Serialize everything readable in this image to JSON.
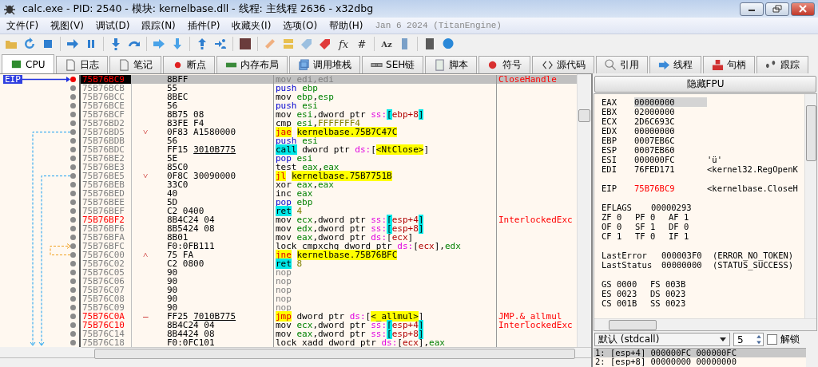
{
  "window": {
    "title": "calc.exe - PID: 2540 - 模块: kernelbase.dll - 线程: 主线程 2636 - x32dbg"
  },
  "menu": [
    "文件(F)",
    "视图(V)",
    "调试(D)",
    "跟踪(N)",
    "插件(P)",
    "收藏夹(I)",
    "选项(O)",
    "帮助(H)"
  ],
  "build_info": "Jan 6 2024 (TitanEngine)",
  "toolbar_glyphs": [
    "fx",
    "#",
    "Az"
  ],
  "tabs": [
    {
      "label": "CPU",
      "selected": true
    },
    {
      "label": "日志",
      "selected": false
    },
    {
      "label": "笔记",
      "selected": false
    },
    {
      "label": "断点",
      "selected": false
    },
    {
      "label": "内存布局",
      "selected": false
    },
    {
      "label": "调用堆栈",
      "selected": false
    },
    {
      "label": "SEH链",
      "selected": false
    },
    {
      "label": "脚本",
      "selected": false
    },
    {
      "label": "符号",
      "selected": false
    },
    {
      "label": "源代码",
      "selected": false
    },
    {
      "label": "引用",
      "selected": false
    },
    {
      "label": "线程",
      "selected": false
    },
    {
      "label": "句柄",
      "selected": false
    },
    {
      "label": "跟踪",
      "selected": false
    }
  ],
  "disassembly": {
    "eip_label": "EIP",
    "rows": [
      {
        "address": "75B76BC9",
        "bytes": "8BFF",
        "tokens": [
          {
            "text": "mov edi,edi",
            "kind": "muted"
          }
        ],
        "comment": "CloseHandle",
        "selected": true,
        "labeled": true
      },
      {
        "address": "75B76BCB",
        "bytes": "55",
        "tokens": [
          {
            "text": "push",
            "kind": "stack"
          },
          {
            "text": " ebp",
            "kind": "register"
          }
        ],
        "selected": false,
        "labeled": false
      },
      {
        "address": "75B76BCC",
        "bytes": "8BEC",
        "tokens": [
          {
            "text": "mov",
            "kind": "mnemonic"
          },
          {
            "text": " ebp",
            "kind": "register"
          },
          {
            "text": ",",
            "kind": "plain"
          },
          {
            "text": "esp",
            "kind": "register"
          }
        ],
        "selected": false,
        "labeled": false
      },
      {
        "address": "75B76BCE",
        "bytes": "56",
        "tokens": [
          {
            "text": "push",
            "kind": "stack"
          },
          {
            "text": " esi",
            "kind": "register"
          }
        ],
        "selected": false,
        "labeled": false
      },
      {
        "address": "75B76BCF",
        "bytes": "8B75 08",
        "tokens": [
          {
            "text": "mov",
            "kind": "mnemonic"
          },
          {
            "text": " esi",
            "kind": "register"
          },
          {
            "text": ",dword ptr ",
            "kind": "plain"
          },
          {
            "text": "ss:",
            "kind": "segment"
          },
          {
            "text": "[",
            "kind": "bracket"
          },
          {
            "text": "ebp+8",
            "kind": "memory"
          },
          {
            "text": "]",
            "kind": "bracket"
          }
        ],
        "selected": false,
        "labeled": false
      },
      {
        "address": "75B76BD2",
        "bytes": "83FE F4",
        "tokens": [
          {
            "text": "cmp",
            "kind": "mnemonic"
          },
          {
            "text": " esi",
            "kind": "register"
          },
          {
            "text": ",",
            "kind": "plain"
          },
          {
            "text": "FFFFFFF4",
            "kind": "number"
          }
        ],
        "selected": false,
        "labeled": false
      },
      {
        "address": "75B76BD5",
        "branch": "˅",
        "bytes": "0F83 A1580000",
        "tokens": [
          {
            "text": "jae",
            "kind": "jump"
          },
          {
            "text": " kernelbase.75B7C47C",
            "kind": "label"
          }
        ],
        "selected": false,
        "labeled": false
      },
      {
        "address": "75B76BDB",
        "bytes": "56",
        "tokens": [
          {
            "text": "push",
            "kind": "stack"
          },
          {
            "text": " esi",
            "kind": "register"
          }
        ],
        "selected": false,
        "labeled": false
      },
      {
        "address": "75B76BDC",
        "bytes": "FF15",
        "bytes_ref": "3010B775",
        "tokens": [
          {
            "text": "call",
            "kind": "call"
          },
          {
            "text": " dword ptr ",
            "kind": "plain"
          },
          {
            "text": "ds:",
            "kind": "segment"
          },
          {
            "text": "[",
            "kind": "plain"
          },
          {
            "text": "<NtClose>",
            "kind": "label"
          },
          {
            "text": "]",
            "kind": "plain"
          }
        ],
        "selected": false,
        "labeled": false
      },
      {
        "address": "75B76BE2",
        "bytes": "5E",
        "tokens": [
          {
            "text": "pop",
            "kind": "stack"
          },
          {
            "text": " esi",
            "kind": "register"
          }
        ],
        "selected": false,
        "labeled": false
      },
      {
        "address": "75B76BE3",
        "bytes": "85C0",
        "tokens": [
          {
            "text": "test",
            "kind": "mnemonic"
          },
          {
            "text": " eax",
            "kind": "register"
          },
          {
            "text": ",",
            "kind": "plain"
          },
          {
            "text": "eax",
            "kind": "register"
          }
        ],
        "selected": false,
        "labeled": false
      },
      {
        "address": "75B76BE5",
        "branch": "˅",
        "bytes": "0F8C 30090000",
        "tokens": [
          {
            "text": "jl",
            "kind": "jump"
          },
          {
            "text": " kernelbase.75B7751B",
            "kind": "label"
          }
        ],
        "selected": false,
        "labeled": false
      },
      {
        "address": "75B76BEB",
        "bytes": "33C0",
        "tokens": [
          {
            "text": "xor",
            "kind": "mnemonic"
          },
          {
            "text": " eax",
            "kind": "register"
          },
          {
            "text": ",",
            "kind": "plain"
          },
          {
            "text": "eax",
            "kind": "register"
          }
        ],
        "selected": false,
        "labeled": false
      },
      {
        "address": "75B76BED",
        "bytes": "40",
        "tokens": [
          {
            "text": "inc",
            "kind": "mnemonic"
          },
          {
            "text": " eax",
            "kind": "register"
          }
        ],
        "selected": false,
        "labeled": false
      },
      {
        "address": "75B76BEE",
        "bytes": "5D",
        "tokens": [
          {
            "text": "pop",
            "kind": "stack"
          },
          {
            "text": " ebp",
            "kind": "register"
          }
        ],
        "selected": false,
        "labeled": false
      },
      {
        "address": "75B76BEF",
        "bytes": "C2 0400",
        "tokens": [
          {
            "text": "ret",
            "kind": "call"
          },
          {
            "text": " 4",
            "kind": "number"
          }
        ],
        "selected": false,
        "labeled": false
      },
      {
        "address": "75B76BF2",
        "bytes": "8B4C24 04",
        "tokens": [
          {
            "text": "mov",
            "kind": "mnemonic"
          },
          {
            "text": " ecx",
            "kind": "register"
          },
          {
            "text": ",dword ptr ",
            "kind": "plain"
          },
          {
            "text": "ss:",
            "kind": "segment"
          },
          {
            "text": "[",
            "kind": "bracket"
          },
          {
            "text": "esp+4",
            "kind": "memory"
          },
          {
            "text": "]",
            "kind": "bracket"
          }
        ],
        "comment": "InterlockedExc",
        "selected": false,
        "labeled": true
      },
      {
        "address": "75B76BF6",
        "bytes": "8B5424 08",
        "tokens": [
          {
            "text": "mov",
            "kind": "mnemonic"
          },
          {
            "text": " edx",
            "kind": "register"
          },
          {
            "text": ",dword ptr ",
            "kind": "plain"
          },
          {
            "text": "ss:",
            "kind": "segment"
          },
          {
            "text": "[",
            "kind": "bracket"
          },
          {
            "text": "esp+8",
            "kind": "memory"
          },
          {
            "text": "]",
            "kind": "bracket"
          }
        ],
        "selected": false,
        "labeled": false
      },
      {
        "address": "75B76BFA",
        "bytes": "8B01",
        "tokens": [
          {
            "text": "mov",
            "kind": "mnemonic"
          },
          {
            "text": " eax",
            "kind": "register"
          },
          {
            "text": ",dword ptr ",
            "kind": "plain"
          },
          {
            "text": "ds:",
            "kind": "segment"
          },
          {
            "text": "[",
            "kind": "plain"
          },
          {
            "text": "ecx",
            "kind": "memory"
          },
          {
            "text": "]",
            "kind": "plain"
          }
        ],
        "selected": false,
        "labeled": false
      },
      {
        "address": "75B76BFC",
        "bytes": "F0:0FB111",
        "tokens": [
          {
            "text": "lock cmpxchg",
            "kind": "mnemonic"
          },
          {
            "text": " dword ptr ",
            "kind": "plain"
          },
          {
            "text": "ds:",
            "kind": "segment"
          },
          {
            "text": "[",
            "kind": "plain"
          },
          {
            "text": "ecx",
            "kind": "memory"
          },
          {
            "text": "],",
            "kind": "plain"
          },
          {
            "text": "edx",
            "kind": "register"
          }
        ],
        "selected": false,
        "labeled": false
      },
      {
        "address": "75B76C00",
        "branch": "˄",
        "bytes": "75 FA",
        "tokens": [
          {
            "text": "jne",
            "kind": "jump"
          },
          {
            "text": " kernelbase.75B76BFC",
            "kind": "label"
          }
        ],
        "selected": false,
        "labeled": false
      },
      {
        "address": "75B76C02",
        "bytes": "C2 0800",
        "tokens": [
          {
            "text": "ret",
            "kind": "call"
          },
          {
            "text": " 8",
            "kind": "number"
          }
        ],
        "selected": false,
        "labeled": false
      },
      {
        "address": "75B76C05",
        "bytes": "90",
        "tokens": [
          {
            "text": "nop",
            "kind": "nop"
          }
        ],
        "selected": false,
        "labeled": false
      },
      {
        "address": "75B76C06",
        "bytes": "90",
        "tokens": [
          {
            "text": "nop",
            "kind": "nop"
          }
        ],
        "selected": false,
        "labeled": false
      },
      {
        "address": "75B76C07",
        "bytes": "90",
        "tokens": [
          {
            "text": "nop",
            "kind": "nop"
          }
        ],
        "selected": false,
        "labeled": false
      },
      {
        "address": "75B76C08",
        "bytes": "90",
        "tokens": [
          {
            "text": "nop",
            "kind": "nop"
          }
        ],
        "selected": false,
        "labeled": false
      },
      {
        "address": "75B76C09",
        "bytes": "90",
        "tokens": [
          {
            "text": "nop",
            "kind": "nop"
          }
        ],
        "selected": false,
        "labeled": false
      },
      {
        "address": "75B76C0A",
        "branch": "–",
        "bytes": "FF25",
        "bytes_ref": "7010B775",
        "tokens": [
          {
            "text": "jmp",
            "kind": "jump"
          },
          {
            "text": " dword ptr ",
            "kind": "plain"
          },
          {
            "text": "ds:",
            "kind": "segment"
          },
          {
            "text": "[",
            "kind": "plain"
          },
          {
            "text": "<_allmul>",
            "kind": "label"
          },
          {
            "text": "]",
            "kind": "plain"
          }
        ],
        "comment": "JMP.&_allmul",
        "selected": false,
        "labeled": true
      },
      {
        "address": "75B76C10",
        "bytes": "8B4C24 04",
        "tokens": [
          {
            "text": "mov",
            "kind": "mnemonic"
          },
          {
            "text": " ecx",
            "kind": "register"
          },
          {
            "text": ",dword ptr ",
            "kind": "plain"
          },
          {
            "text": "ss:",
            "kind": "segment"
          },
          {
            "text": "[",
            "kind": "bracket"
          },
          {
            "text": "esp+4",
            "kind": "memory"
          },
          {
            "text": "]",
            "kind": "bracket"
          }
        ],
        "comment": "InterlockedExc",
        "selected": false,
        "labeled": true
      },
      {
        "address": "75B76C14",
        "bytes": "8B4424 08",
        "tokens": [
          {
            "text": "mov",
            "kind": "mnemonic"
          },
          {
            "text": " eax",
            "kind": "register"
          },
          {
            "text": ",dword ptr ",
            "kind": "plain"
          },
          {
            "text": "ss:",
            "kind": "segment"
          },
          {
            "text": "[",
            "kind": "bracket"
          },
          {
            "text": "esp+8",
            "kind": "memory"
          },
          {
            "text": "]",
            "kind": "bracket"
          }
        ],
        "selected": false,
        "labeled": false
      },
      {
        "address": "75B76C18",
        "bytes": "F0:0FC101",
        "tokens": [
          {
            "text": "lock xadd",
            "kind": "mnemonic"
          },
          {
            "text": " dword ptr ",
            "kind": "plain"
          },
          {
            "text": "ds:",
            "kind": "segment"
          },
          {
            "text": "[",
            "kind": "plain"
          },
          {
            "text": "ecx",
            "kind": "memory"
          },
          {
            "text": "],",
            "kind": "plain"
          },
          {
            "text": "eax",
            "kind": "register"
          }
        ],
        "selected": false,
        "labeled": false
      }
    ]
  },
  "fpu_button": "隐藏FPU",
  "register_groups": [
    [
      {
        "name": "EAX",
        "value": "00000000",
        "selected": true,
        "changed": false
      },
      {
        "name": "EBX",
        "value": "02000000",
        "selected": false,
        "changed": false
      },
      {
        "name": "ECX",
        "value": "2D6C693C",
        "selected": false,
        "changed": false
      },
      {
        "name": "EDX",
        "value": "00000000",
        "selected": false,
        "changed": false
      },
      {
        "name": "EBP",
        "value": "0007EB6C",
        "selected": false,
        "changed": false
      },
      {
        "name": "ESP",
        "value": "0007EB60",
        "selected": false,
        "changed": false
      },
      {
        "name": "ESI",
        "value": "000000FC",
        "comment": "'ü'",
        "selected": false,
        "changed": false
      },
      {
        "name": "EDI",
        "value": "76FED171",
        "comment": "<kernel32.RegOpenK",
        "selected": false,
        "changed": false
      }
    ],
    [
      {
        "name": "EIP",
        "value": "75B76BC9",
        "comment": "<kernelbase.CloseH",
        "selected": false,
        "changed": true
      }
    ]
  ],
  "eflags": {
    "name": "EFLAGS",
    "value": "00000293"
  },
  "flags": [
    {
      "name": "ZF",
      "value": "0"
    },
    {
      "name": "PF",
      "value": "0"
    },
    {
      "name": "AF",
      "value": "1"
    },
    {
      "name": "OF",
      "value": "0"
    },
    {
      "name": "SF",
      "value": "1"
    },
    {
      "name": "DF",
      "value": "0"
    },
    {
      "name": "CF",
      "value": "1"
    },
    {
      "name": "TF",
      "value": "0"
    },
    {
      "name": "IF",
      "value": "1"
    }
  ],
  "status": [
    {
      "name": "LastError",
      "value": "000003F0",
      "comment": "(ERROR_NO_TOKEN)"
    },
    {
      "name": "LastStatus",
      "value": "00000000",
      "comment": "(STATUS_SUCCESS)"
    }
  ],
  "segments": [
    {
      "name": "GS",
      "value": "0000"
    },
    {
      "name": "FS",
      "value": "003B"
    },
    {
      "name": "ES",
      "value": "0023"
    },
    {
      "name": "DS",
      "value": "0023"
    },
    {
      "name": "CS",
      "value": "001B"
    },
    {
      "name": "SS",
      "value": "0023"
    }
  ],
  "calling_convention": "默认 (stdcall)",
  "arg_count": "5",
  "unlock": {
    "label": "解锁",
    "checked": false
  },
  "stack_args": [
    {
      "text": "1: [esp+4] 000000FC 000000FC",
      "selected": true
    },
    {
      "text": "2: [esp+8] 00000000 00000000",
      "selected": false
    }
  ]
}
